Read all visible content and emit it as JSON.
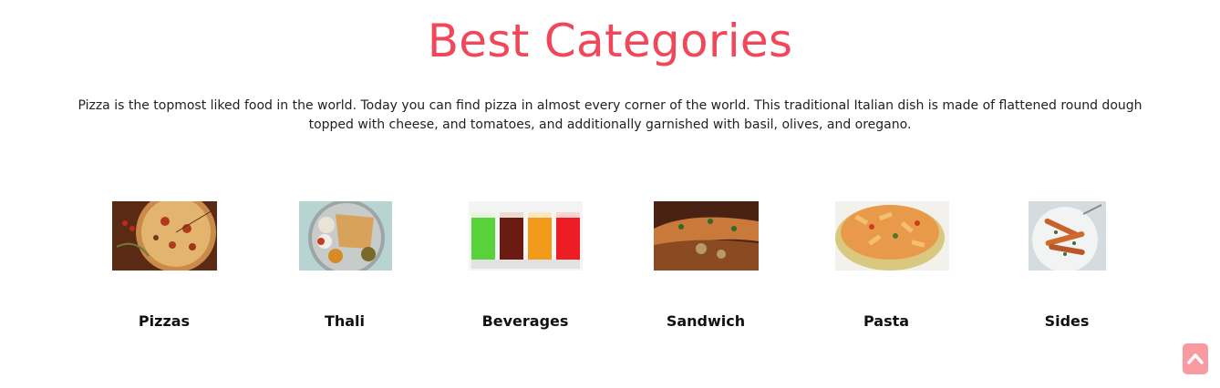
{
  "section": {
    "title": "Best Categories",
    "description": "Pizza is the topmost liked food in the world. Today you can find pizza in almost every corner of the world. This traditional Italian dish is made of flattened round dough topped with cheese, and tomatoes, and additionally garnished with basil, olives, and oregano."
  },
  "categories": [
    {
      "label": "Pizzas",
      "image": "pizza-image"
    },
    {
      "label": "Thali",
      "image": "thali-image"
    },
    {
      "label": "Beverages",
      "image": "beverages-image"
    },
    {
      "label": "Sandwich",
      "image": "sandwich-image"
    },
    {
      "label": "Pasta",
      "image": "pasta-image"
    },
    {
      "label": "Sides",
      "image": "sides-image"
    }
  ],
  "scroll_top": {
    "icon": "chevron-up-icon"
  },
  "colors": {
    "accent": "#f0485a",
    "scroll_button": "#f99aa1"
  }
}
